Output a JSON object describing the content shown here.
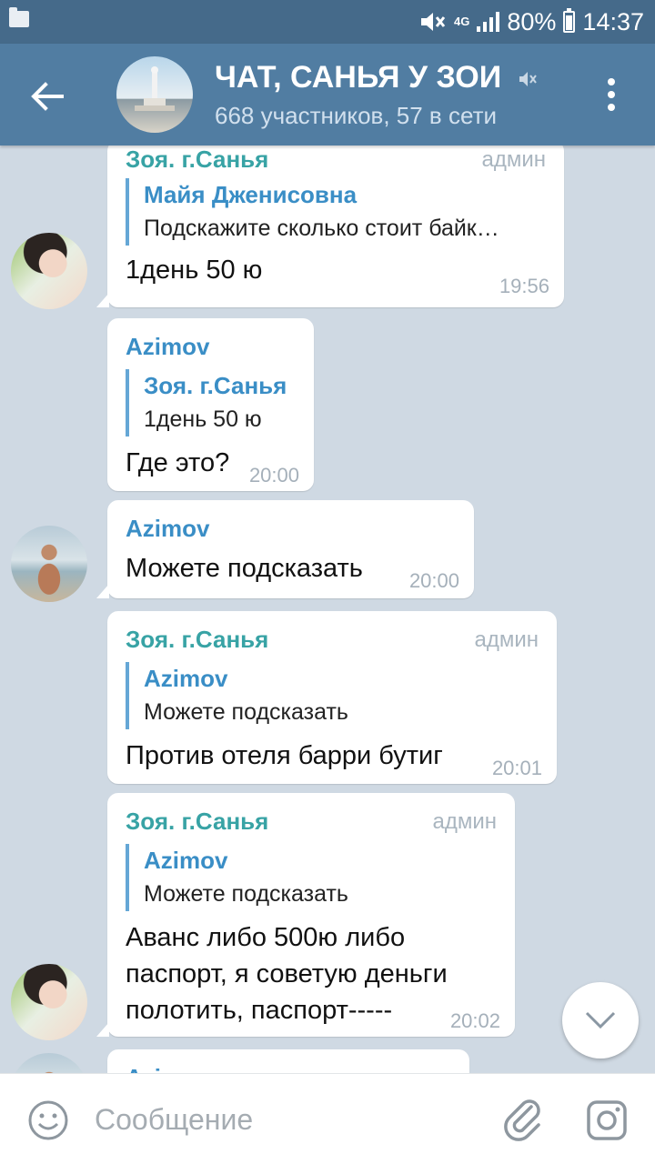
{
  "status_bar": {
    "network": "4G",
    "battery": "80%",
    "time": "14:37"
  },
  "header": {
    "title": "ЧАТ, САНЬЯ У ЗОИ",
    "subtitle": "668 участников, 57 в сети"
  },
  "messages": [
    {
      "sender": "Зоя. г.Санья",
      "role": "админ",
      "reply_name": "Майя Дженисовна",
      "reply_text": "Подскажите сколько стоит байк…",
      "lines": [
        "1день 50 ю"
      ],
      "time": "19:56"
    },
    {
      "sender": "Azimov",
      "reply_name": "Зоя. г.Санья",
      "reply_text": "1день 50 ю",
      "lines": [
        "Где это?"
      ],
      "time": "20:00"
    },
    {
      "sender": "Azimov",
      "lines": [
        "Можете подсказать"
      ],
      "time": "20:00"
    },
    {
      "sender": "Зоя. г.Санья",
      "role": "админ",
      "reply_name": "Azimov",
      "reply_text": "Можете подсказать",
      "lines": [
        "Против отеля барри бутиг"
      ],
      "time": "20:01"
    },
    {
      "sender": "Зоя. г.Санья",
      "role": "админ",
      "reply_name": "Azimov",
      "reply_text": "Можете подсказать",
      "lines": [
        "Аванс либо 500ю либо",
        "паспорт,  я советую деньги",
        "полотить, паспорт-----"
      ],
      "time": "20:02"
    },
    {
      "sender": "Azimov"
    }
  ],
  "input": {
    "placeholder": "Сообщение"
  },
  "colors": {
    "header_bg": "#517da2",
    "status_bg": "#456a8a",
    "chat_bg": "#cfd9e3",
    "sender_blue": "#3a8ec6",
    "sender_teal": "#38a3a5"
  }
}
